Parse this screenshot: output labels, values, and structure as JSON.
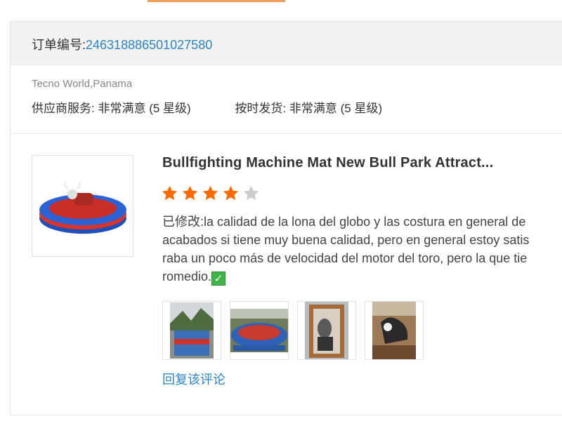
{
  "order": {
    "label": "订单编号:",
    "number": "2463188865010275​80"
  },
  "supplier": {
    "name": "Tecno World,Panama",
    "service_label": "供应商服务:",
    "service_value": "非常满意",
    "service_stars": "(5 星级)",
    "shipping_label": "按时发货:",
    "shipping_value": "非常满意",
    "shipping_stars": "(5 星级)"
  },
  "review": {
    "product_title": "Bullfighting Machine Mat New Bull Park Attract...",
    "rating": 4,
    "rating_max": 5,
    "modified_label": "已修改:",
    "comment_line1": "la calidad de la lona del globo  y las costura en general de",
    "comment_line2": "acabados si tiene muy buena calidad, pero en general estoy satis",
    "comment_line3": "raba un poco más de velocidad del motor del toro, pero la que tie",
    "comment_line4": "romedio.",
    "reply_link": "回复该评论"
  },
  "colors": {
    "star_filled": "#ff6a00",
    "star_empty": "#cccccc",
    "link": "#2a86c8",
    "accent": "#f5a05a"
  }
}
